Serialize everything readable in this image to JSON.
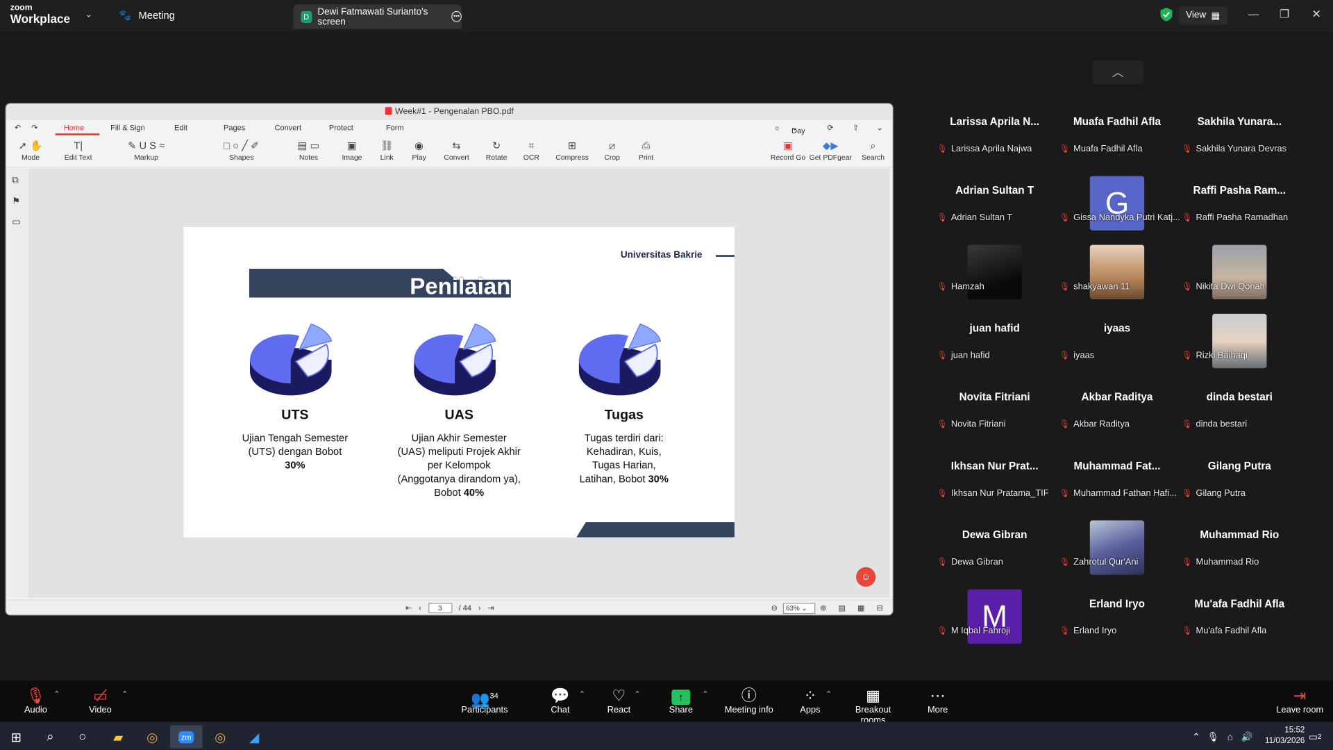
{
  "window": {
    "logo_line1": "zoom",
    "logo_line2": "Workplace",
    "meeting_label": "Meeting",
    "screen_tab": "Dewi Fatmawati Surianto's screen",
    "view_label": "View"
  },
  "pdf": {
    "title": "Week#1 - Pengenalan PBO.pdf",
    "menus": [
      "Home",
      "Fill & Sign",
      "Edit",
      "Pages",
      "Convert",
      "Protect",
      "Form"
    ],
    "day_mode": "Day",
    "tools": [
      {
        "icon": "cursor-icon",
        "label": "Mode"
      },
      {
        "icon": "text-edit-icon",
        "label": "Edit Text"
      },
      {
        "icon": "markup-icon",
        "label": "Markup"
      },
      {
        "icon": "shapes-icon",
        "label": "Shapes"
      },
      {
        "icon": "notes-icon",
        "label": "Notes"
      },
      {
        "icon": "image-icon",
        "label": "Image"
      },
      {
        "icon": "link-icon",
        "label": "Link"
      },
      {
        "icon": "play-icon",
        "label": "Play"
      },
      {
        "icon": "convert-icon",
        "label": "Convert"
      },
      {
        "icon": "rotate-icon",
        "label": "Rotate"
      },
      {
        "icon": "ocr-icon",
        "label": "OCR"
      },
      {
        "icon": "compress-icon",
        "label": "Compress"
      },
      {
        "icon": "crop-icon",
        "label": "Crop"
      },
      {
        "icon": "print-icon",
        "label": "Print"
      },
      {
        "icon": "record-icon",
        "label": "Record Go"
      },
      {
        "icon": "pdfgear-icon",
        "label": "Get PDFgear"
      },
      {
        "icon": "search-icon",
        "label": "Search"
      }
    ],
    "page_current": "3",
    "page_total": "/ 44",
    "zoom": "63%"
  },
  "slide": {
    "university": "Universitas Bakrie",
    "title": "Penilaian",
    "columns": [
      {
        "head": "UTS",
        "body_lines": [
          "Ujian Tengah Semester",
          "(UTS) dengan Bobot"
        ],
        "bold": "30%"
      },
      {
        "head": "UAS",
        "body_lines": [
          "Ujian Akhir Semester",
          "(UAS) meliputi Projek Akhir",
          "per Kelompok",
          "(Anggotanya dirandom ya),",
          "Bobot "
        ],
        "bold": "40%"
      },
      {
        "head": "Tugas",
        "body_lines": [
          "Tugas terdiri dari:",
          "Kehadiran, Kuis,",
          "Tugas Harian,",
          "Latihan, Bobot "
        ],
        "bold": "30%"
      }
    ]
  },
  "participants": [
    {
      "name": "Larissa Aprila N...",
      "label": "Larissa Aprila Najwa"
    },
    {
      "name": "Muafa Fadhil Afla",
      "label": "Muafa Fadhil Afla"
    },
    {
      "name": "Sakhila  Yunara...",
      "label": "Sakhila Yunara Devras"
    },
    {
      "name": "Adrian Sultan T",
      "label": "Adrian Sultan T"
    },
    {
      "name": "",
      "label": "Gissa Nandyka Putri Katj...",
      "avatar_letter": "G",
      "avatar_color": "#5865c8"
    },
    {
      "name": "Raffi Pasha Ram...",
      "label": "Raffi Pasha Ramadhan"
    },
    {
      "name": "",
      "label": "Hamzah",
      "photo": "dark"
    },
    {
      "name": "",
      "label": "shakyawan 11",
      "photo": "face"
    },
    {
      "name": "",
      "label": "Nikita Dwi Qoriah",
      "photo": "room"
    },
    {
      "name": "juan hafid",
      "label": "juan hafid"
    },
    {
      "name": "iyaas",
      "label": "iyaas"
    },
    {
      "name": "",
      "label": "Rizki Baihaqi",
      "photo": "face2"
    },
    {
      "name": "Novita Fitriani",
      "label": "Novita Fitriani"
    },
    {
      "name": "Akbar Raditya",
      "label": "Akbar Raditya"
    },
    {
      "name": "dinda bestari",
      "label": "dinda bestari"
    },
    {
      "name": "Ikhsan  Nur  Prat...",
      "label": "Ikhsan Nur Pratama_TIF"
    },
    {
      "name": "Muhammad  Fat...",
      "label": "Muhammad Fathan Hafi..."
    },
    {
      "name": "Gilang Putra",
      "label": "Gilang Putra"
    },
    {
      "name": "Dewa Gibran",
      "label": "Dewa Gibran"
    },
    {
      "name": "",
      "label": "Zahrotul Qur'Ani",
      "photo": "flowers"
    },
    {
      "name": "Muhammad Rio",
      "label": "Muhammad Rio"
    },
    {
      "name": "",
      "label": "M Iqbal Fahroji",
      "avatar_letter": "M",
      "avatar_color": "#5a1fa8"
    },
    {
      "name": "Erland Iryo",
      "label": "Erland Iryo"
    },
    {
      "name": "Mu'afa Fadhil Afla",
      "label": "Mu'afa Fadhil Afla"
    }
  ],
  "toolbar": {
    "audio": "Audio",
    "video": "Video",
    "participants": "Participants",
    "participant_count": "34",
    "chat": "Chat",
    "react": "React",
    "share": "Share",
    "meeting_info": "Meeting info",
    "apps": "Apps",
    "breakout": "Breakout rooms",
    "more": "More",
    "leave": "Leave room"
  },
  "taskbar": {
    "time": "15:52",
    "date": "11/03/2026",
    "notif_count": "2"
  }
}
